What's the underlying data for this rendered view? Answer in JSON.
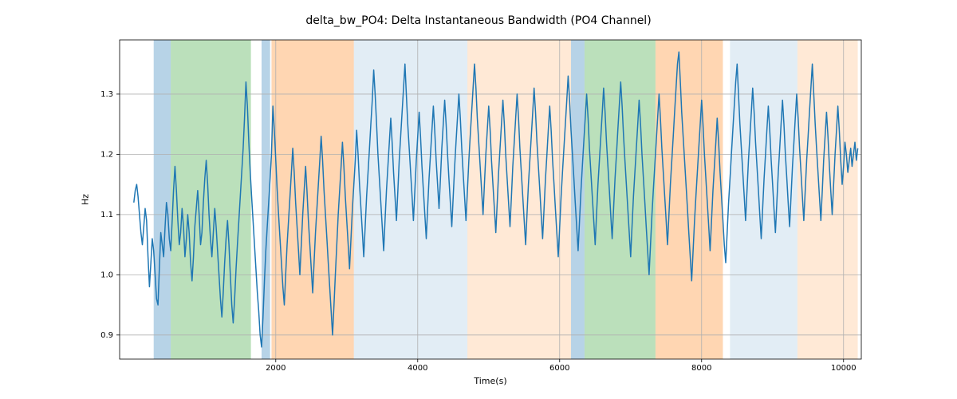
{
  "chart_data": {
    "type": "line",
    "title": "delta_bw_PO4: Delta Instantaneous Bandwidth (PO4 Channel)",
    "xlabel": "Time(s)",
    "ylabel": "Hz",
    "xlim": [
      -200,
      10250
    ],
    "ylim": [
      0.86,
      1.39
    ],
    "xticks": [
      2000,
      4000,
      6000,
      8000,
      10000
    ],
    "yticks": [
      0.9,
      1.0,
      1.1,
      1.2,
      1.3
    ],
    "bands": [
      {
        "x0": 280,
        "x1": 520,
        "class": "band-blue"
      },
      {
        "x0": 520,
        "x1": 1650,
        "class": "band-green"
      },
      {
        "x0": 1800,
        "x1": 1920,
        "class": "band-blue"
      },
      {
        "x0": 1940,
        "x1": 3100,
        "class": "band-orange"
      },
      {
        "x0": 3100,
        "x1": 4700,
        "class": "band-lightblue"
      },
      {
        "x0": 4700,
        "x1": 6160,
        "class": "band-lightorange"
      },
      {
        "x0": 6160,
        "x1": 6350,
        "class": "band-blue"
      },
      {
        "x0": 6350,
        "x1": 7350,
        "class": "band-green"
      },
      {
        "x0": 7350,
        "x1": 8300,
        "class": "band-orange"
      },
      {
        "x0": 8400,
        "x1": 9350,
        "class": "band-lightblue"
      },
      {
        "x0": 9350,
        "x1": 10200,
        "class": "band-lightorange"
      }
    ],
    "series": [
      {
        "name": "delta_bw_PO4",
        "x_step": 20,
        "x_start": 0,
        "values": [
          1.12,
          1.14,
          1.15,
          1.13,
          1.1,
          1.07,
          1.05,
          1.08,
          1.11,
          1.09,
          1.03,
          0.98,
          1.02,
          1.06,
          1.04,
          1.0,
          0.96,
          0.95,
          1.01,
          1.07,
          1.05,
          1.03,
          1.08,
          1.12,
          1.1,
          1.06,
          1.04,
          1.09,
          1.14,
          1.18,
          1.14,
          1.09,
          1.05,
          1.07,
          1.11,
          1.08,
          1.03,
          1.06,
          1.1,
          1.07,
          1.02,
          0.99,
          1.03,
          1.08,
          1.11,
          1.14,
          1.1,
          1.05,
          1.07,
          1.12,
          1.16,
          1.19,
          1.15,
          1.1,
          1.06,
          1.03,
          1.07,
          1.11,
          1.08,
          1.04,
          1.0,
          0.96,
          0.93,
          0.97,
          1.02,
          1.06,
          1.09,
          1.05,
          1.0,
          0.95,
          0.92,
          0.96,
          1.01,
          1.05,
          1.09,
          1.13,
          1.17,
          1.21,
          1.26,
          1.32,
          1.28,
          1.22,
          1.17,
          1.13,
          1.09,
          1.05,
          1.01,
          0.97,
          0.94,
          0.9,
          0.88,
          0.93,
          0.99,
          1.04,
          1.08,
          1.12,
          1.16,
          1.2,
          1.28,
          1.24,
          1.19,
          1.14,
          1.1,
          1.06,
          1.02,
          0.98,
          0.95,
          1.0,
          1.05,
          1.09,
          1.13,
          1.17,
          1.21,
          1.17,
          1.12,
          1.08,
          1.04,
          1.0,
          1.05,
          1.1,
          1.14,
          1.18,
          1.14,
          1.09,
          1.05,
          1.01,
          0.97,
          1.02,
          1.07,
          1.11,
          1.15,
          1.19,
          1.23,
          1.19,
          1.14,
          1.1,
          1.06,
          1.02,
          0.98,
          0.94,
          0.9,
          0.95,
          1.0,
          1.05,
          1.1,
          1.14,
          1.18,
          1.22,
          1.18,
          1.13,
          1.09,
          1.05,
          1.01,
          1.06,
          1.11,
          1.15,
          1.19,
          1.24,
          1.2,
          1.15,
          1.11,
          1.07,
          1.03,
          1.08,
          1.13,
          1.17,
          1.21,
          1.25,
          1.29,
          1.34,
          1.3,
          1.25,
          1.2,
          1.16,
          1.12,
          1.08,
          1.04,
          1.09,
          1.14,
          1.18,
          1.22,
          1.26,
          1.22,
          1.17,
          1.13,
          1.09,
          1.14,
          1.19,
          1.23,
          1.27,
          1.31,
          1.35,
          1.3,
          1.25,
          1.21,
          1.17,
          1.13,
          1.09,
          1.14,
          1.19,
          1.23,
          1.27,
          1.23,
          1.18,
          1.14,
          1.1,
          1.06,
          1.11,
          1.16,
          1.2,
          1.24,
          1.28,
          1.24,
          1.19,
          1.15,
          1.11,
          1.16,
          1.21,
          1.25,
          1.29,
          1.25,
          1.2,
          1.16,
          1.12,
          1.08,
          1.13,
          1.18,
          1.22,
          1.26,
          1.3,
          1.26,
          1.21,
          1.17,
          1.13,
          1.09,
          1.14,
          1.19,
          1.23,
          1.27,
          1.31,
          1.35,
          1.31,
          1.26,
          1.22,
          1.18,
          1.14,
          1.1,
          1.15,
          1.2,
          1.24,
          1.28,
          1.24,
          1.19,
          1.15,
          1.11,
          1.07,
          1.12,
          1.17,
          1.21,
          1.25,
          1.29,
          1.25,
          1.2,
          1.16,
          1.12,
          1.08,
          1.13,
          1.18,
          1.22,
          1.26,
          1.3,
          1.26,
          1.21,
          1.17,
          1.13,
          1.09,
          1.05,
          1.1,
          1.15,
          1.19,
          1.23,
          1.27,
          1.31,
          1.27,
          1.22,
          1.18,
          1.14,
          1.1,
          1.06,
          1.11,
          1.16,
          1.2,
          1.24,
          1.28,
          1.24,
          1.19,
          1.15,
          1.11,
          1.07,
          1.03,
          1.08,
          1.13,
          1.17,
          1.21,
          1.25,
          1.29,
          1.33,
          1.29,
          1.24,
          1.2,
          1.16,
          1.12,
          1.08,
          1.04,
          1.09,
          1.14,
          1.18,
          1.22,
          1.26,
          1.3,
          1.26,
          1.21,
          1.17,
          1.13,
          1.09,
          1.05,
          1.1,
          1.15,
          1.19,
          1.23,
          1.27,
          1.31,
          1.27,
          1.22,
          1.18,
          1.14,
          1.1,
          1.06,
          1.11,
          1.16,
          1.2,
          1.24,
          1.28,
          1.32,
          1.28,
          1.23,
          1.19,
          1.15,
          1.11,
          1.07,
          1.03,
          1.08,
          1.13,
          1.17,
          1.21,
          1.25,
          1.29,
          1.25,
          1.2,
          1.16,
          1.12,
          1.08,
          1.04,
          1.0,
          1.05,
          1.1,
          1.14,
          1.18,
          1.22,
          1.26,
          1.3,
          1.26,
          1.21,
          1.17,
          1.13,
          1.09,
          1.05,
          1.1,
          1.15,
          1.19,
          1.23,
          1.27,
          1.31,
          1.35,
          1.37,
          1.32,
          1.27,
          1.23,
          1.19,
          1.15,
          1.11,
          1.07,
          1.03,
          0.99,
          1.04,
          1.09,
          1.13,
          1.17,
          1.21,
          1.25,
          1.29,
          1.25,
          1.2,
          1.16,
          1.12,
          1.08,
          1.04,
          1.09,
          1.14,
          1.18,
          1.22,
          1.26,
          1.22,
          1.17,
          1.13,
          1.09,
          1.05,
          1.02,
          1.07,
          1.12,
          1.16,
          1.2,
          1.24,
          1.28,
          1.32,
          1.35,
          1.3,
          1.25,
          1.21,
          1.17,
          1.13,
          1.09,
          1.14,
          1.19,
          1.23,
          1.27,
          1.31,
          1.27,
          1.22,
          1.18,
          1.14,
          1.1,
          1.06,
          1.11,
          1.16,
          1.2,
          1.24,
          1.28,
          1.24,
          1.19,
          1.15,
          1.11,
          1.07,
          1.12,
          1.17,
          1.21,
          1.25,
          1.29,
          1.25,
          1.2,
          1.16,
          1.12,
          1.08,
          1.13,
          1.18,
          1.22,
          1.26,
          1.3,
          1.26,
          1.21,
          1.17,
          1.13,
          1.09,
          1.14,
          1.19,
          1.23,
          1.27,
          1.31,
          1.35,
          1.3,
          1.25,
          1.21,
          1.17,
          1.13,
          1.09,
          1.14,
          1.19,
          1.23,
          1.27,
          1.23,
          1.18,
          1.14,
          1.1,
          1.15,
          1.2,
          1.24,
          1.28,
          1.24,
          1.19,
          1.15,
          1.18,
          1.22,
          1.2,
          1.17,
          1.19,
          1.21,
          1.18,
          1.2,
          1.22,
          1.19,
          1.21
        ]
      }
    ]
  }
}
